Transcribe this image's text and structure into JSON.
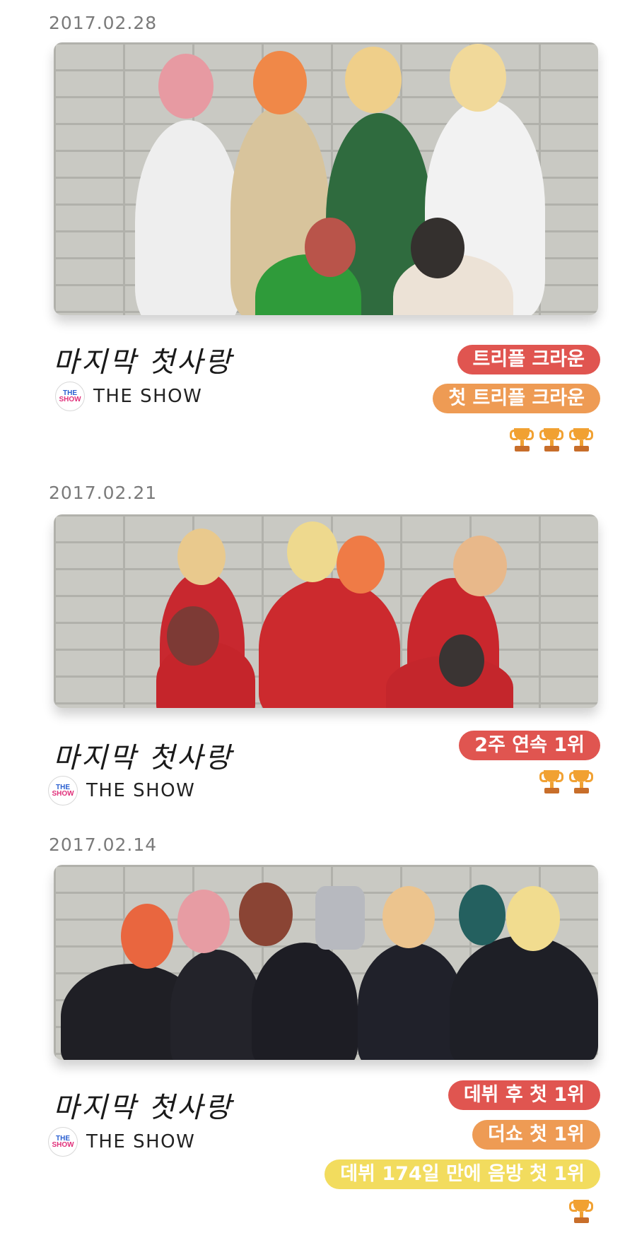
{
  "entries": [
    {
      "date": "2017.02.28",
      "song": "마지막 첫사랑",
      "show": "THE SHOW",
      "logo_top": "THE",
      "logo_bottom": "SHOW",
      "badges": [
        {
          "label": "트리플 크라운",
          "color": "#e05550"
        },
        {
          "label": "첫 트리플 크라운",
          "color": "#ee9b54"
        }
      ],
      "trophy_count": 3
    },
    {
      "date": "2017.02.21",
      "song": "마지막 첫사랑",
      "show": "THE SHOW",
      "logo_top": "THE",
      "logo_bottom": "SHOW",
      "badges": [
        {
          "label": "2주 연속 1위",
          "color": "#e05550"
        }
      ],
      "trophy_count": 2
    },
    {
      "date": "2017.02.14",
      "song": "마지막 첫사랑",
      "show": "THE SHOW",
      "logo_top": "THE",
      "logo_bottom": "SHOW",
      "badges": [
        {
          "label": "데뷔 후 첫 1위",
          "color": "#e05550"
        },
        {
          "label": "더쇼 첫 1위",
          "color": "#ee9b54"
        },
        {
          "label": "데뷔 174일 만에 음방 첫 1위",
          "color": "#f2dc5e"
        }
      ],
      "trophy_count": 1
    }
  ],
  "trophy_icon": "trophy-icon"
}
